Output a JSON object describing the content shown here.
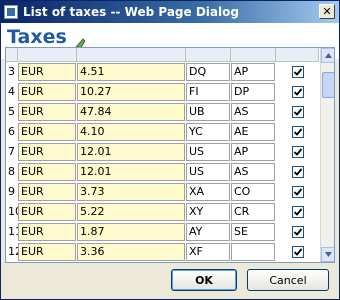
{
  "window": {
    "title": "List of taxes -- Web Page Dialog",
    "close_label": "✕"
  },
  "header": {
    "heading": "Taxes"
  },
  "rows": [
    {
      "num": "3",
      "currency": "EUR",
      "amount": "4.51",
      "code1": "DQ",
      "code2": "AP",
      "checked": true
    },
    {
      "num": "4",
      "currency": "EUR",
      "amount": "10.27",
      "code1": "FI",
      "code2": "DP",
      "checked": true
    },
    {
      "num": "5",
      "currency": "EUR",
      "amount": "47.84",
      "code1": "UB",
      "code2": "AS",
      "checked": true
    },
    {
      "num": "6",
      "currency": "EUR",
      "amount": "4.10",
      "code1": "YC",
      "code2": "AE",
      "checked": true
    },
    {
      "num": "7",
      "currency": "EUR",
      "amount": "12.01",
      "code1": "US",
      "code2": "AP",
      "checked": true
    },
    {
      "num": "8",
      "currency": "EUR",
      "amount": "12.01",
      "code1": "US",
      "code2": "AS",
      "checked": true
    },
    {
      "num": "9",
      "currency": "EUR",
      "amount": "3.73",
      "code1": "XA",
      "code2": "CO",
      "checked": true
    },
    {
      "num": "10",
      "currency": "EUR",
      "amount": "5.22",
      "code1": "XY",
      "code2": "CR",
      "checked": true
    },
    {
      "num": "11",
      "currency": "EUR",
      "amount": "1.87",
      "code1": "AY",
      "code2": "SE",
      "checked": true
    },
    {
      "num": "12",
      "currency": "EUR",
      "amount": "3.36",
      "code1": "XF",
      "code2": "",
      "checked": true
    }
  ],
  "footer": {
    "ok_label": "OK",
    "cancel_label": "Cancel"
  },
  "colors": {
    "heading": "#1f5aa3",
    "cell_yellow": "#fffacd",
    "titlebar": "#0a246a"
  }
}
